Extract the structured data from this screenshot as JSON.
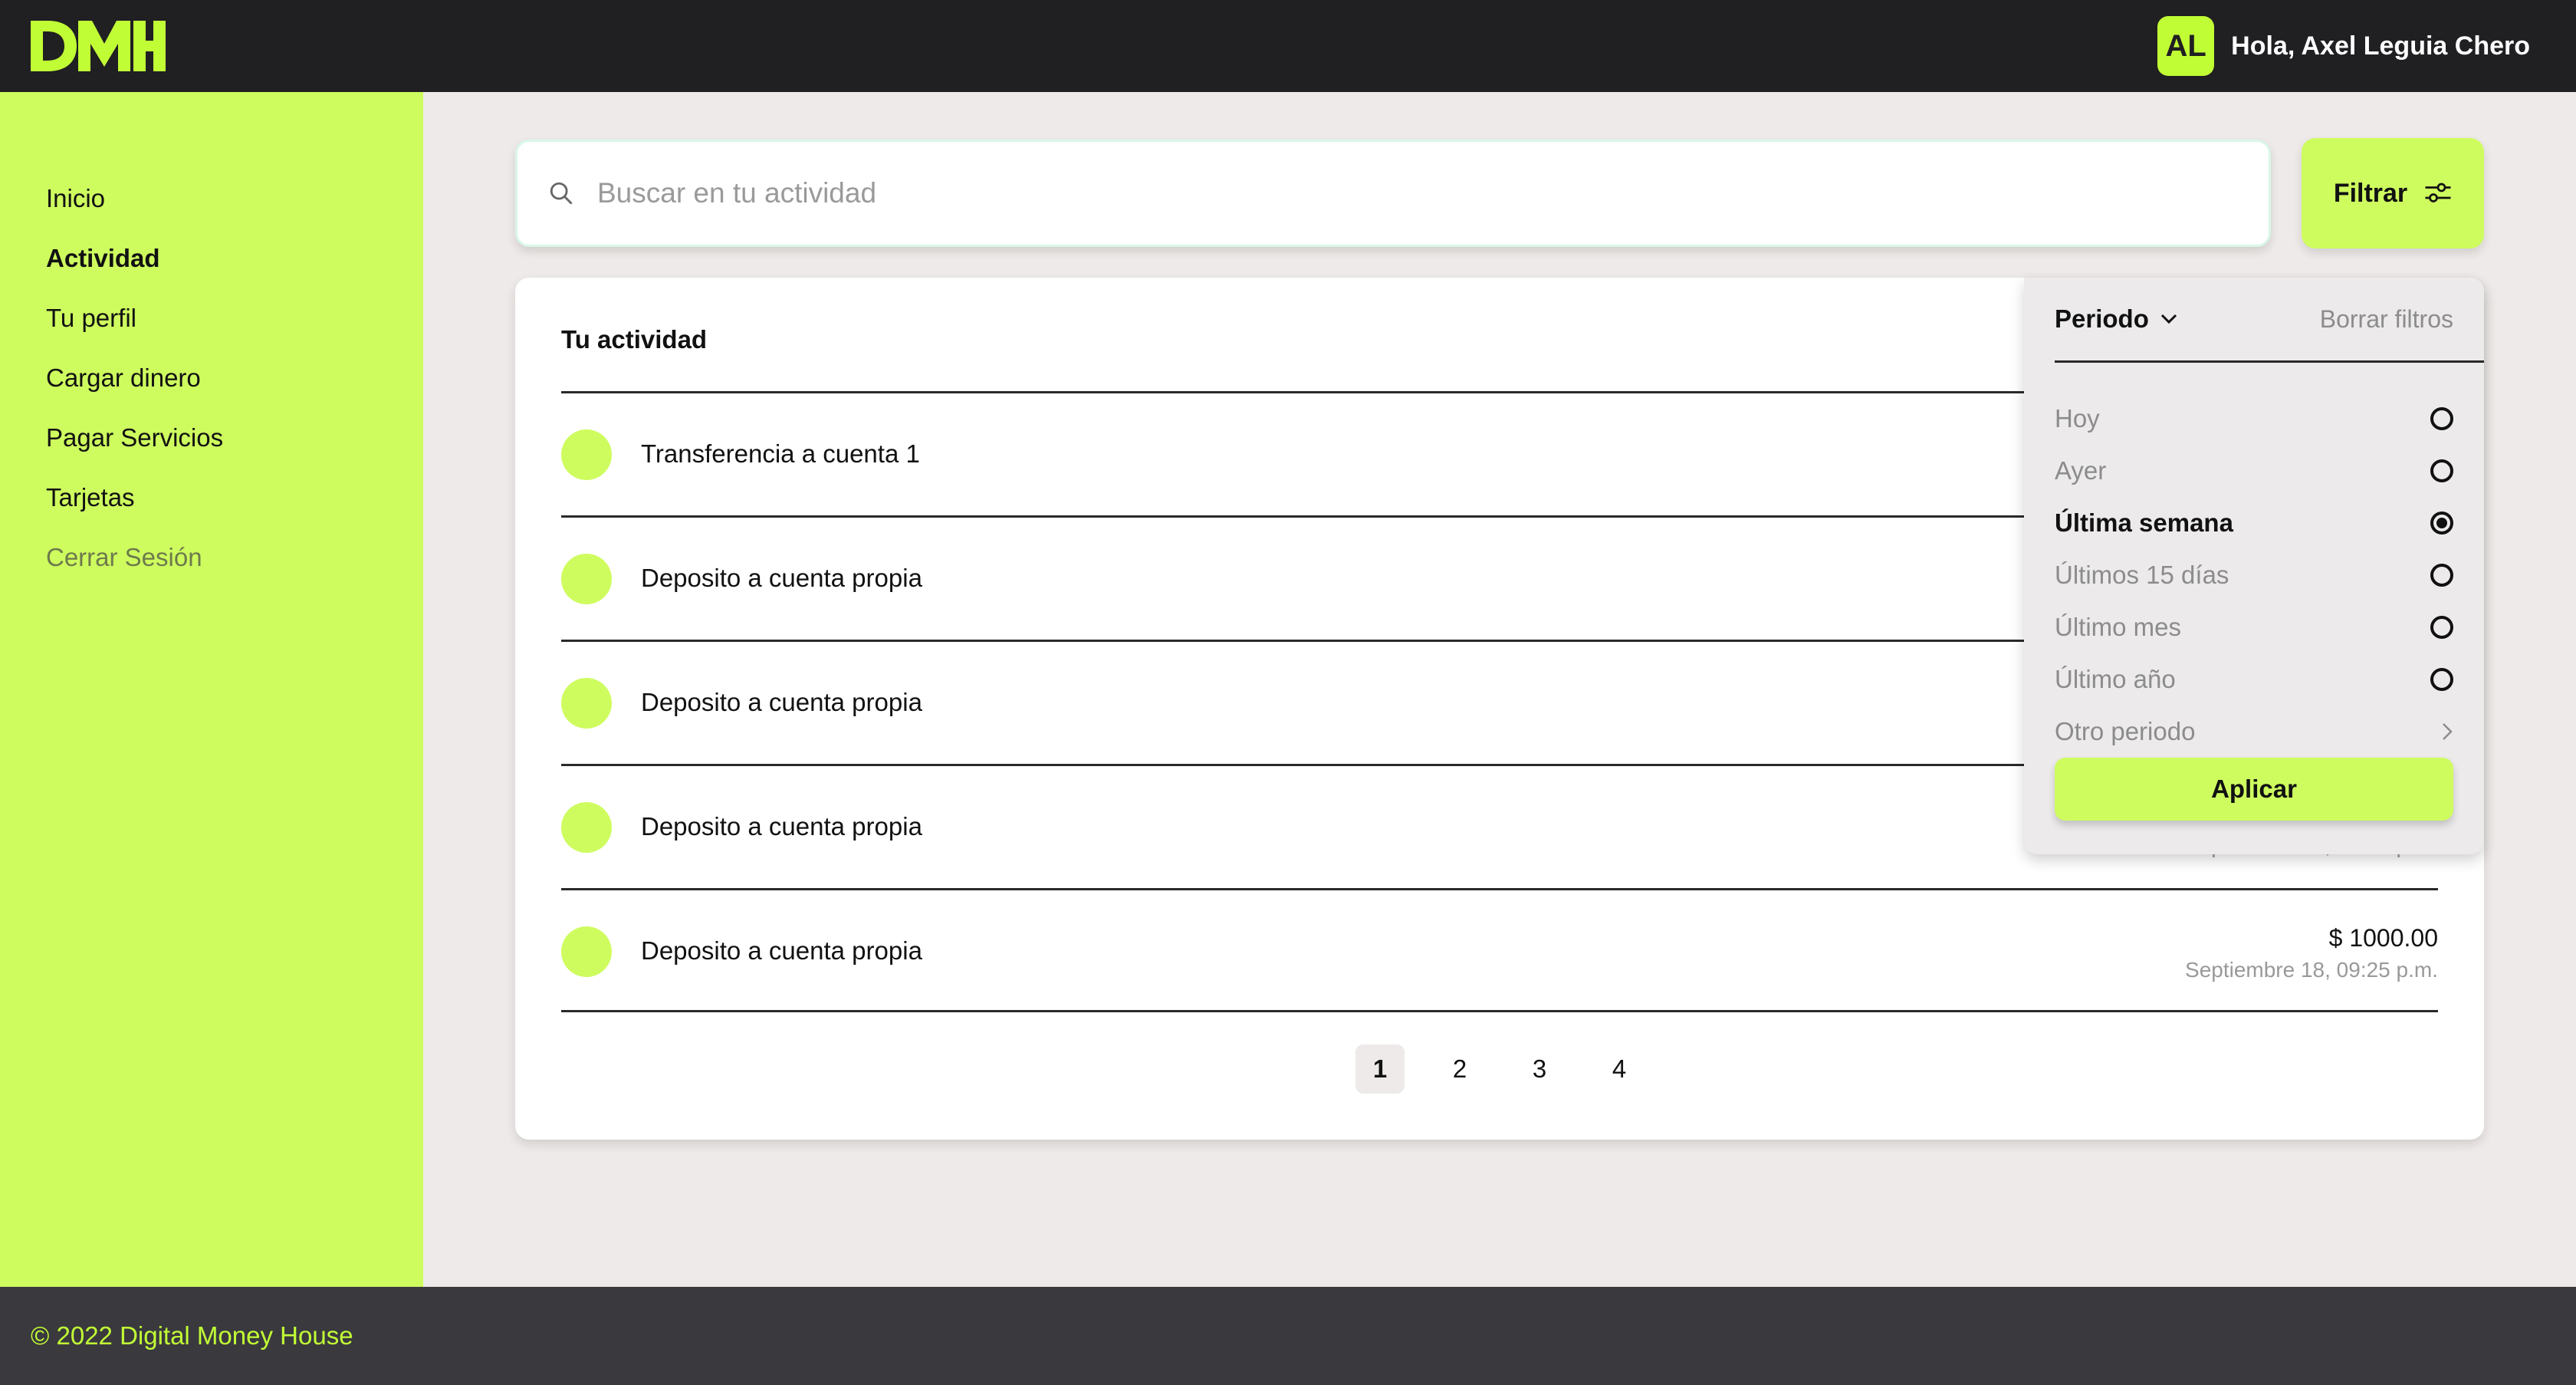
{
  "header": {
    "logo_text": "DMH",
    "avatar_initials": "AL",
    "greeting": "Hola, Axel Leguia Chero"
  },
  "sidebar": {
    "items": [
      {
        "label": "Inicio"
      },
      {
        "label": "Actividad"
      },
      {
        "label": "Tu perfil"
      },
      {
        "label": "Cargar dinero"
      },
      {
        "label": "Pagar Servicios"
      },
      {
        "label": "Tarjetas"
      },
      {
        "label": "Cerrar Sesión"
      }
    ],
    "active": "Actividad"
  },
  "search": {
    "placeholder": "Buscar en tu actividad",
    "value": ""
  },
  "filter_button": {
    "label": "Filtrar"
  },
  "activity": {
    "title": "Tu actividad",
    "rows": [
      {
        "label": "Transferencia a cuenta 1",
        "amount": "",
        "date": ""
      },
      {
        "label": "Deposito a cuenta propia",
        "amount": "",
        "date": ""
      },
      {
        "label": "Deposito a cuenta propia",
        "amount": "",
        "date": ""
      },
      {
        "label": "Deposito a cuenta propia",
        "amount": "",
        "date": "Septiembre 18, 09:25 p.m."
      },
      {
        "label": "Deposito a cuenta propia",
        "amount": "$ 1000.00",
        "date": "Septiembre 18, 09:25 p.m."
      }
    ],
    "pages": [
      "1",
      "2",
      "3",
      "4"
    ],
    "current_page": "1"
  },
  "filter_panel": {
    "period_label": "Periodo",
    "clear_label": "Borrar filtros",
    "options": [
      {
        "label": "Hoy",
        "selected": false
      },
      {
        "label": "Ayer",
        "selected": false
      },
      {
        "label": "Última semana",
        "selected": true
      },
      {
        "label": "Últimos 15 días",
        "selected": false
      },
      {
        "label": "Último mes",
        "selected": false
      },
      {
        "label": "Último año",
        "selected": false
      }
    ],
    "other_period_label": "Otro periodo",
    "apply_label": "Aplicar"
  },
  "footer": {
    "text": "© 2022 Digital Money House"
  },
  "colors": {
    "accent": "#C1FD35",
    "sidebar_bg": "#CEFC5F",
    "header_bg": "#201F22",
    "footer_bg": "#3A393E",
    "page_bg": "#EEEAE9"
  }
}
